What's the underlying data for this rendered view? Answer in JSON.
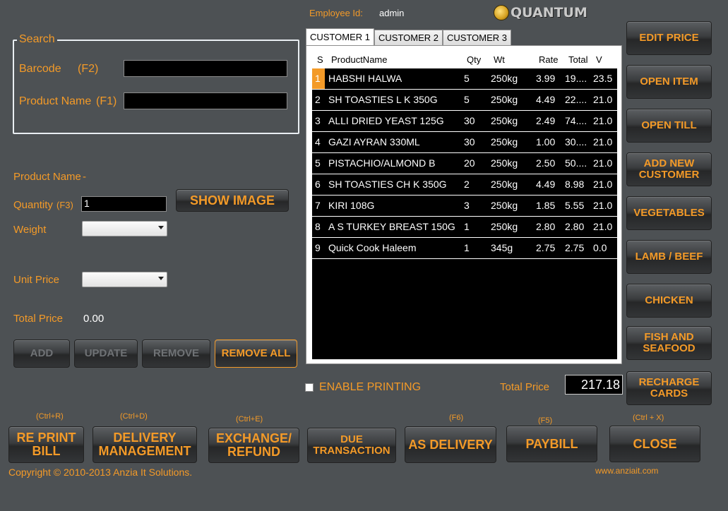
{
  "header": {
    "employee_label": "Employee Id:",
    "employee_value": "admin",
    "logo_text": "QUANTUM",
    "logo_icon": "globe-logo-icon"
  },
  "search": {
    "title": "Search",
    "barcode_label": "Barcode",
    "barcode_hotkey": "(F2)",
    "barcode_value": "",
    "product_name_label": "Product Name",
    "product_name_hotkey": "(F1)",
    "product_name_value": ""
  },
  "details": {
    "product_name_label": "Product Name",
    "product_name_value": "-",
    "quantity_label": "Quantity",
    "quantity_hotkey": "(F3)",
    "quantity_value": "1",
    "show_image_button": "SHOW IMAGE",
    "weight_label": "Weight",
    "weight_value": "",
    "unit_price_label": "Unit Price",
    "unit_price_value": "",
    "total_price_label": "Total Price",
    "total_price_value": "0.00"
  },
  "actions": {
    "add": "ADD",
    "update": "UPDATE",
    "remove": "REMOVE",
    "remove_all": "REMOVE ALL"
  },
  "tabs": [
    {
      "label": "CUSTOMER 1",
      "active": true
    },
    {
      "label": "CUSTOMER 2",
      "active": false
    },
    {
      "label": "CUSTOMER 3",
      "active": false
    }
  ],
  "grid": {
    "columns": [
      "S",
      "ProductName",
      "Qty",
      "Wt",
      "Rate",
      "Total",
      "V"
    ],
    "rows": [
      {
        "s": "1",
        "name": "HABSHI HALWA",
        "qty": "5",
        "wt": "250kg",
        "rate": "3.99",
        "total": "19....",
        "v": "23.5"
      },
      {
        "s": "2",
        "name": "SH TOASTIES L K 350G",
        "qty": "5",
        "wt": "250kg",
        "rate": "4.49",
        "total": "22....",
        "v": "21.0"
      },
      {
        "s": "3",
        "name": "ALLI DRIED YEAST 125G",
        "qty": "30",
        "wt": "250kg",
        "rate": "2.49",
        "total": "74....",
        "v": "21.0"
      },
      {
        "s": "4",
        "name": "GAZI AYRAN 330ML",
        "qty": "30",
        "wt": "250kg",
        "rate": "1.00",
        "total": "30....",
        "v": "21.0"
      },
      {
        "s": "5",
        "name": "PISTACHIO/ALMOND B",
        "qty": "20",
        "wt": "250kg",
        "rate": "2.50",
        "total": "50....",
        "v": "21.0"
      },
      {
        "s": "6",
        "name": "SH TOASTIES CH K 350G",
        "qty": "2",
        "wt": "250kg",
        "rate": "4.49",
        "total": "8.98",
        "v": "21.0"
      },
      {
        "s": "7",
        "name": "KIRI 108G",
        "qty": "3",
        "wt": "250kg",
        "rate": "1.85",
        "total": "5.55",
        "v": "21.0"
      },
      {
        "s": "8",
        "name": "A S TURKEY BREAST 150G",
        "qty": "1",
        "wt": "250kg",
        "rate": "2.80",
        "total": "2.80",
        "v": "21.0"
      },
      {
        "s": "9",
        "name": "Quick Cook Haleem",
        "qty": "1",
        "wt": "345g",
        "rate": "2.75",
        "total": "2.75",
        "v": "0.0"
      }
    ]
  },
  "printing": {
    "enable_label": "ENABLE PRINTING",
    "checked": false
  },
  "total": {
    "label": "Total Price",
    "value": "217.18"
  },
  "side_buttons": [
    {
      "id": "edit-price",
      "label": "EDIT PRICE"
    },
    {
      "id": "open-item",
      "label": "OPEN ITEM"
    },
    {
      "id": "open-till",
      "label": "OPEN TILL"
    },
    {
      "id": "add-new-customer",
      "label": "ADD NEW CUSTOMER"
    },
    {
      "id": "vegetables",
      "label": "VEGETABLES"
    },
    {
      "id": "lamb-beef",
      "label": "LAMB / BEEF"
    },
    {
      "id": "chicken",
      "label": "CHICKEN"
    },
    {
      "id": "fish-seafood",
      "label": "FISH AND SEAFOOD"
    },
    {
      "id": "recharge-cards",
      "label": "RECHARGE CARDS"
    }
  ],
  "bottom_buttons": [
    {
      "id": "reprint-bill",
      "label": "RE PRINT BILL",
      "hotkey": "(Ctrl+R)"
    },
    {
      "id": "delivery-management",
      "label": "DELIVERY MANAGEMENT",
      "hotkey": "(Ctrl+D)"
    },
    {
      "id": "exchange-refund",
      "label": "EXCHANGE/ REFUND",
      "hotkey": "(Ctrl+E)"
    },
    {
      "id": "due-transaction",
      "label": "DUE TRANSACTION",
      "hotkey": ""
    },
    {
      "id": "as-delivery",
      "label": "AS DELIVERY",
      "hotkey": "(F6)"
    },
    {
      "id": "paybill",
      "label": "PAYBILL",
      "hotkey": "(F5)"
    },
    {
      "id": "close",
      "label": "CLOSE",
      "hotkey": "(Ctrl + X)"
    }
  ],
  "footer": {
    "copyright": "Copyright © 2010-2013 Anzia It Solutions.",
    "website": "www.anziait.com"
  }
}
